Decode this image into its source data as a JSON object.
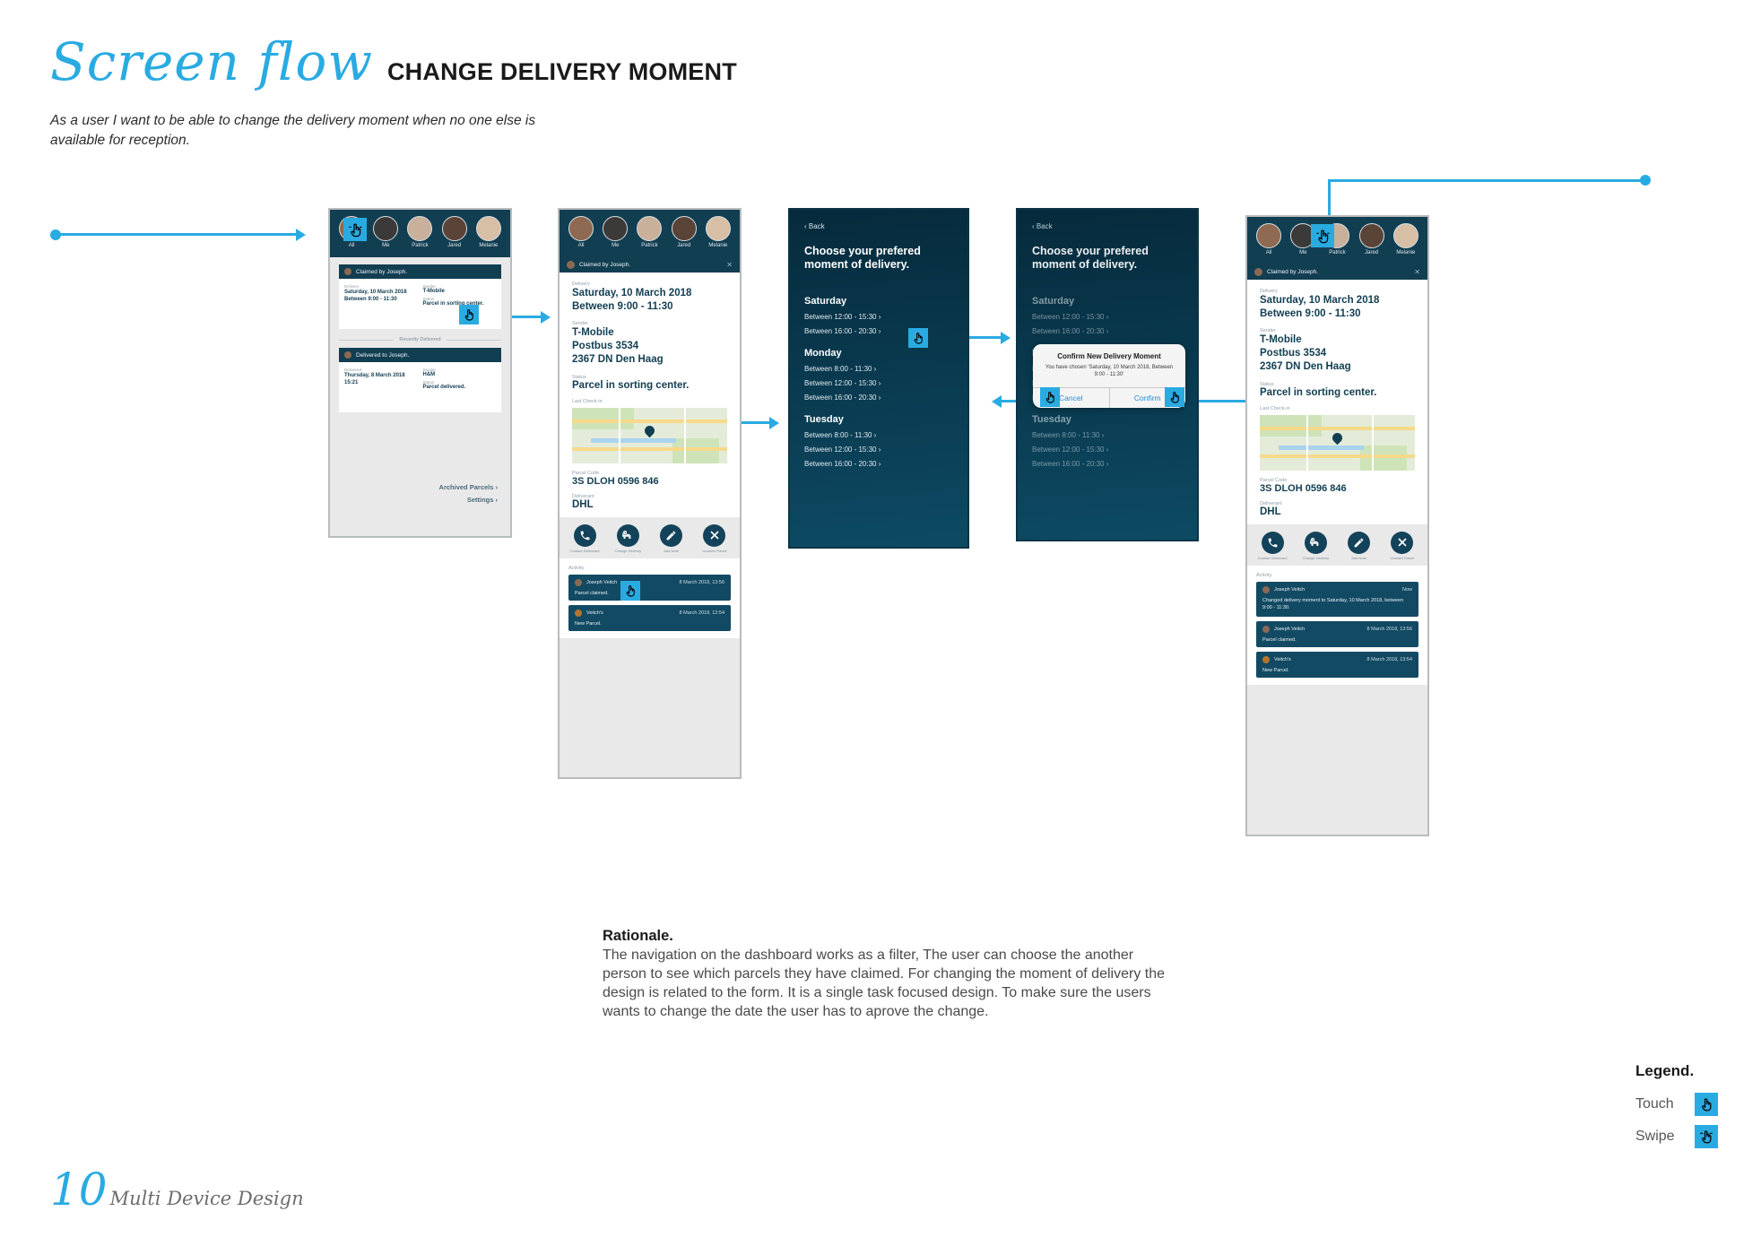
{
  "header": {
    "title_script": "Screen flow",
    "title_bold": "CHANGE DELIVERY MOMENT",
    "subtitle": "As a user I want to be able to change the delivery moment when no one else is available for reception."
  },
  "nav": {
    "items": [
      {
        "label": "All"
      },
      {
        "label": "Me"
      },
      {
        "label": "Patrick"
      },
      {
        "label": "Jared"
      },
      {
        "label": "Melanie"
      }
    ]
  },
  "screen1": {
    "claimed_bar": "Claimed by Joseph.",
    "delivery_label": "Delivery",
    "delivery_line1": "Saturday, 10 March 2018",
    "delivery_line2": "Between 9:00 - 11:30",
    "sender_label": "Sender",
    "sender_value": "T-Mobile",
    "status_label": "Status",
    "status_value": "Parcel in sorting center.",
    "separator": "Recently Delivered",
    "delivered_bar": "Delivered to Joseph.",
    "delivered_label": "Delivered",
    "delivered_line1": "Thursday, 8 March 2018",
    "delivered_line2": "15:21",
    "delivered_sender_label": "Sender",
    "delivered_sender_value": "H&M",
    "delivered_status_label": "Status",
    "delivered_status_value": "Parcel delivered.",
    "archived_link": "Archived Parcels ›",
    "settings_link": "Settings ›"
  },
  "screen2": {
    "claimed_bar": "Claimed by Joseph.",
    "delivery_label": "Delivery",
    "delivery_line1": "Saturday, 10 March 2018",
    "delivery_line2": "Between 9:00 - 11:30",
    "sender_label": "Sender",
    "sender_line1": "T-Mobile",
    "sender_line2": "Postbus 3534",
    "sender_line3": "2367 DN Den Haag",
    "status_label": "Status",
    "status_value": "Parcel in sorting center.",
    "checkin_label": "Last Check-in",
    "parcelcode_label": "Parcel Code",
    "parcelcode_value": "3S DLOH 0596 846",
    "deliverant_label": "Deliverant",
    "deliverant_value": "DHL",
    "actions": [
      {
        "icon": "phone-icon",
        "label": "Contact Deliverant"
      },
      {
        "icon": "truck-clock-icon",
        "label": "Change Delivery"
      },
      {
        "icon": "pencil-icon",
        "label": "Add Note"
      },
      {
        "icon": "close-icon",
        "label": "Unclaim Parcel"
      }
    ],
    "activity_label": "Activity",
    "activity": [
      {
        "user": "Joseph Veitch",
        "time": "8 March 2018, 13:56",
        "text": "Parcel claimed."
      },
      {
        "user": "Veitch's",
        "time": "8 March 2018, 13:54",
        "text": "New Parcel."
      }
    ]
  },
  "screen3": {
    "back": "‹ Back",
    "question": "Choose your prefered moment of delivery.",
    "days": [
      {
        "name": "Saturday",
        "slots": [
          "Between 12:00 - 15:30 ›",
          "Between 16:00 - 20:30 ›"
        ]
      },
      {
        "name": "Monday",
        "slots": [
          "Between 8:00 - 11:30 ›",
          "Between 12:00 - 15:30 ›",
          "Between 16:00 - 20:30 ›"
        ]
      },
      {
        "name": "Tuesday",
        "slots": [
          "Between 8:00 - 11:30 ›",
          "Between 12:00 - 15:30 ›",
          "Between 16:00 - 20:30 ›"
        ]
      }
    ]
  },
  "screen4": {
    "back": "‹ Back",
    "question": "Choose your prefered moment of delivery.",
    "days": [
      {
        "name": "Saturday",
        "slots": [
          "Between 12:00 - 15:30 ›",
          "Between 16:00 - 20:30 ›"
        ]
      },
      {
        "name": "Monday",
        "slots": [
          "Between 8:00 - 11:30 ›",
          "Between 12:00 - 15:30 ›",
          "Between 16:00 - 20:30 ›"
        ]
      },
      {
        "name": "Tuesday",
        "slots": [
          "Between 8:00 - 11:30 ›",
          "Between 12:00 - 15:30 ›",
          "Between 16:00 - 20:30 ›"
        ]
      }
    ],
    "modal": {
      "title": "Confirm New Delivery Moment",
      "subtitle": "You have chosen 'Saturday, 10 March 2018, Between 9:00 - 11:30'",
      "cancel": "Cancel",
      "confirm": "Confirm"
    }
  },
  "screen5": {
    "claimed_bar": "Claimed by Joseph.",
    "delivery_label": "Delivery",
    "delivery_line1": "Saturday, 10 March 2018",
    "delivery_line2": "Between 9:00 - 11:30",
    "sender_label": "Sender",
    "sender_line1": "T-Mobile",
    "sender_line2": "Postbus 3534",
    "sender_line3": "2367 DN Den Haag",
    "status_label": "Status",
    "status_value": "Parcel in sorting center.",
    "checkin_label": "Last Check-in",
    "parcelcode_label": "Parcel Code",
    "parcelcode_value": "3S DLOH 0596 846",
    "deliverant_label": "Deliverant",
    "deliverant_value": "DHL",
    "actions": [
      {
        "icon": "phone-icon",
        "label": "Contact Deliverant"
      },
      {
        "icon": "truck-clock-icon",
        "label": "Change Delivery"
      },
      {
        "icon": "pencil-icon",
        "label": "Add Note"
      },
      {
        "icon": "close-icon",
        "label": "Unclaim Parcel"
      }
    ],
    "activity_label": "Activity",
    "activity": [
      {
        "user": "Joseph Veitch",
        "time": "Now",
        "text": "Changed delivery moment  to  Saturday, 10 March 2018, between 9:00 - 11:30."
      },
      {
        "user": "Joseph Veitch",
        "time": "8 March 2018, 13:56",
        "text": "Parcel claimed."
      },
      {
        "user": "Veitch's",
        "time": "8 March 2018, 13:54",
        "text": "New Parcel."
      }
    ]
  },
  "rationale": {
    "heading": "Rationale.",
    "body": "The navigation on the dashboard works as a filter, The user can choose the another person to see which parcels they have claimed. For changing the moment of delivery the design is related to the form. It is a single task focused design. To make sure the users wants to change the date the user has to aprove the change."
  },
  "legend": {
    "heading": "Legend.",
    "items": [
      {
        "label": "Touch",
        "icon": "touch-icon"
      },
      {
        "label": "Swipe",
        "icon": "swipe-icon"
      }
    ]
  },
  "footer": {
    "page_number": "10",
    "deck_title": "Multi Device Design"
  },
  "colors": {
    "accent": "#29ABE2",
    "dark_navy": "#123e52",
    "panel": "#e9e9e9"
  }
}
